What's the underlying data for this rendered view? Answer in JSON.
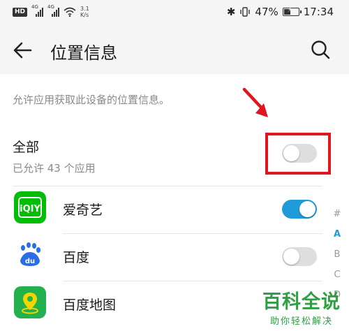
{
  "status_bar": {
    "hd_label": "HD",
    "signal_label_1": "4G",
    "signal_label_2": "4G",
    "speed_value": "3.1",
    "speed_unit": "K/s",
    "battery_level": 47,
    "battery_text": "47%",
    "time": "17:34"
  },
  "header": {
    "title": "位置信息"
  },
  "description": "允许应用获取此设备的位置信息。",
  "all_apps": {
    "title": "全部",
    "subtitle": "已允许 43 个应用",
    "toggle_on": false
  },
  "apps": [
    {
      "name": "爱奇艺",
      "icon": "iqiyi-icon",
      "icon_text": "iQIY",
      "enabled": true,
      "color": "#00be06"
    },
    {
      "name": "百度",
      "icon": "baidu-icon",
      "icon_text": "du",
      "enabled": false,
      "color": "#2b6de5"
    },
    {
      "name": "百度地图",
      "icon": "baidu-map-icon",
      "enabled": false,
      "color": "#23b14d"
    }
  ],
  "alphabet_index": [
    "#",
    "A",
    "B",
    "C",
    "D"
  ],
  "alphabet_active": "A",
  "watermark": {
    "main": "百科全说",
    "sub": "助你轻松解决"
  },
  "colors": {
    "accent": "#1f9bd9",
    "highlight": "#e0161e",
    "watermark": "#2ea043"
  }
}
